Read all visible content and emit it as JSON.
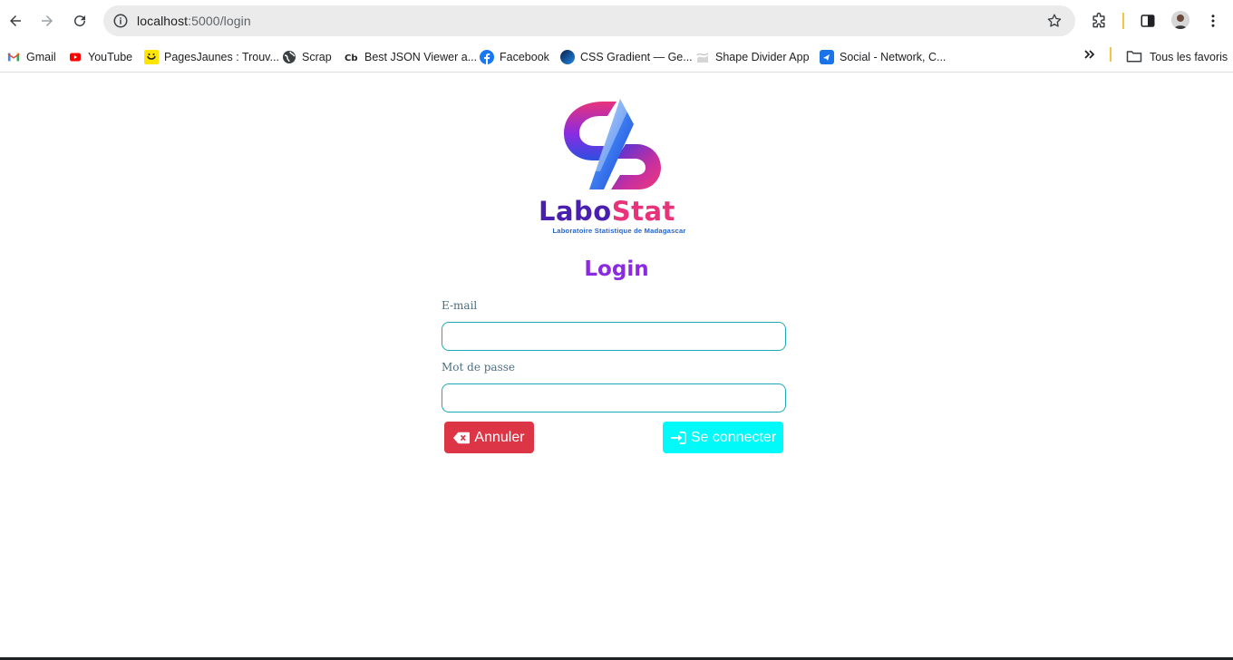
{
  "browser": {
    "url_host": "localhost",
    "url_path": ":5000/login",
    "icons": {
      "back": "back-arrow-icon",
      "forward": "forward-arrow-icon",
      "reload": "reload-icon",
      "site_info": "info-icon",
      "bookmark_star": "star-icon",
      "extensions": "puzzle-icon",
      "side_panel": "side-panel-icon",
      "menu": "kebab-menu-icon"
    }
  },
  "bookmarks": {
    "items": [
      {
        "label": "Gmail",
        "icon": "gmail-icon"
      },
      {
        "label": "YouTube",
        "icon": "youtube-icon"
      },
      {
        "label": "PagesJaunes : Trouv...",
        "icon": "pagesjaunes-icon"
      },
      {
        "label": "Scrap",
        "icon": "globe-icon"
      },
      {
        "label": "Best JSON Viewer a...",
        "icon": "cb-icon"
      },
      {
        "label": "Facebook",
        "icon": "facebook-icon"
      },
      {
        "label": "CSS Gradient — Ge...",
        "icon": "css-gradient-icon"
      },
      {
        "label": "Shape Divider App",
        "icon": "shape-divider-icon"
      },
      {
        "label": "Social - Network, C...",
        "icon": "social-icon"
      }
    ],
    "all_bookmarks_label": "Tous les favoris"
  },
  "logo": {
    "title_part1": "Labo",
    "title_part2": "Stat",
    "subtitle": "Laboratoire Statistique de Madagascar"
  },
  "form": {
    "title": "Login",
    "email_label": "E-mail",
    "email_value": "",
    "password_label": "Mot de passe",
    "password_value": "",
    "cancel_label": "Annuler",
    "submit_label": "Se connecter"
  },
  "colors": {
    "title": "#8a2be2",
    "input_border": "#20a8b8",
    "cancel_button": "#dc3545",
    "submit_button": "#00fafa"
  }
}
